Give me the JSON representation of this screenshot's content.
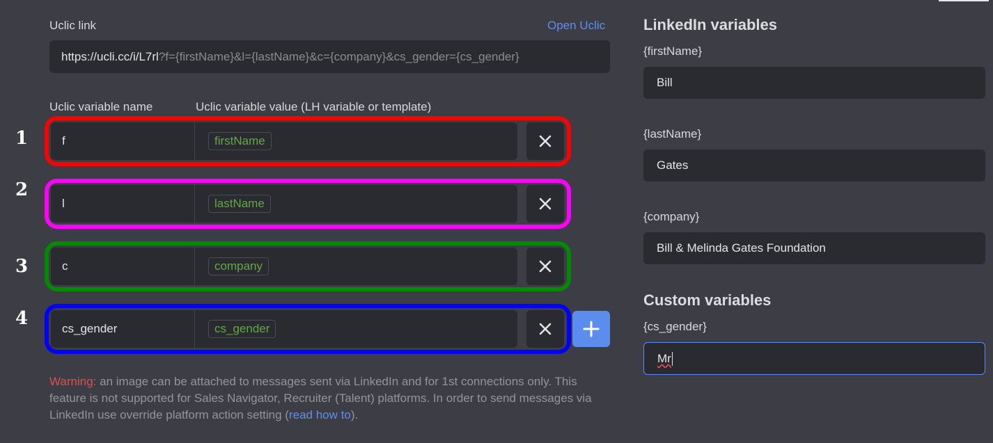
{
  "link": {
    "label": "Uclic link",
    "open_label": "Open Uclic",
    "url_base": "https://ucli.cc/i/L7rl",
    "url_params": "?f={firstName}&l={lastName}&c={company}&cs_gender={cs_gender}"
  },
  "table": {
    "name_header": "Uclic variable name",
    "value_header": "Uclic variable value (LH variable or template)",
    "rows": [
      {
        "number": "1",
        "name": "f",
        "value": "firstName",
        "frame_color": "#ff0000"
      },
      {
        "number": "2",
        "name": "l",
        "value": "lastName",
        "frame_color": "#ff00ff"
      },
      {
        "number": "3",
        "name": "c",
        "value": "company",
        "frame_color": "#008a00"
      },
      {
        "number": "4",
        "name": "cs_gender",
        "value": "cs_gender",
        "frame_color": "#0000ff"
      }
    ],
    "remove_icon": "close-icon",
    "add_icon": "plus-icon"
  },
  "warning": {
    "prefix": "Warning:",
    "text": " an image can be attached to messages sent via LinkedIn and for 1st connections only. This feature is not supported for Sales Navigator, Recruiter (Talent) platforms. In order to send messages via LinkedIn use override platform action setting (",
    "link": "read how to",
    "suffix": ")."
  },
  "linkedin": {
    "title": "LinkedIn variables",
    "fields": [
      {
        "label": "{firstName}",
        "value": "Bill"
      },
      {
        "label": "{lastName}",
        "value": "Gates"
      },
      {
        "label": "{company}",
        "value": "Bill & Melinda Gates Foundation"
      }
    ]
  },
  "custom": {
    "title": "Custom variables",
    "fields": [
      {
        "label": "{cs_gender}",
        "value": "Mr"
      }
    ]
  },
  "colors": {
    "background": "#3c3d45",
    "field": "#2a2b30",
    "accent": "#5b8def",
    "chip_text": "#63a845",
    "warning": "#e0504e"
  }
}
